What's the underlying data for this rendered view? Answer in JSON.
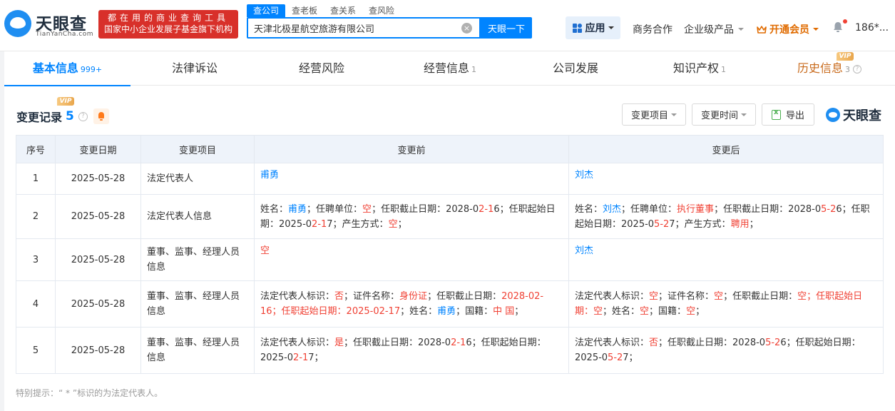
{
  "header": {
    "logo_text": "天眼查",
    "logo_sub": "TianYanCha.com",
    "promo_line1": "都在用的商业查询工具",
    "promo_line2": "国家中小企业发展子基金旗下机构",
    "search_tabs": [
      "查公司",
      "查老板",
      "查关系",
      "查风险"
    ],
    "search_value": "天津北极星航空旅游有限公司",
    "search_button": "天眼一下",
    "apps_label": "应用",
    "nav": {
      "business": "商务合作",
      "enterprise": "企业级产品",
      "vip": "开通会员",
      "user": "186*..."
    }
  },
  "tabs": [
    {
      "label": "基本信息",
      "count": "999+"
    },
    {
      "label": "法律诉讼",
      "count": ""
    },
    {
      "label": "经营风险",
      "count": ""
    },
    {
      "label": "经营信息",
      "count": "1"
    },
    {
      "label": "公司发展",
      "count": ""
    },
    {
      "label": "知识产权",
      "count": "1"
    },
    {
      "label": "历史信息",
      "count": "3"
    }
  ],
  "vip_badge": "VIP",
  "section": {
    "title": "变更记录",
    "count": "5",
    "filter_item": "变更项目",
    "filter_time": "变更时间",
    "export": "导出",
    "brand": "天眼查"
  },
  "table": {
    "headers": [
      "序号",
      "变更日期",
      "变更项目",
      "变更前",
      "变更后"
    ],
    "rows": [
      {
        "no": "1",
        "date": "2025-05-28",
        "item": "法定代表人"
      },
      {
        "no": "2",
        "date": "2025-05-28",
        "item": "法定代表人信息"
      },
      {
        "no": "3",
        "date": "2025-05-28",
        "item": "董事、监事、经理人员信息"
      },
      {
        "no": "4",
        "date": "2025-05-28",
        "item": "董事、监事、经理人员信息"
      },
      {
        "no": "5",
        "date": "2025-05-28",
        "item": "董事、监事、经理人员信息"
      }
    ],
    "text": {
      "r1_before": "甫勇",
      "r1_after": "刘杰",
      "r2b_a": "姓名：",
      "r2b_b": "甫勇",
      "r2b_c": "；任聘单位：",
      "r2b_d": "空",
      "r2b_e": "；任职截止日期：2028-0",
      "r2b_f": "2-1",
      "r2b_g": "6；任职起始日期：2025-0",
      "r2b_h": "2-1",
      "r2b_i": "7；产生方式：",
      "r2b_j": "空",
      "r2b_k": "；",
      "r2a_a": "姓名：",
      "r2a_b": "刘杰",
      "r2a_c": "；任聘单位：",
      "r2a_d": "执行董事",
      "r2a_e": "；任职截止日期：2028-0",
      "r2a_f": "5-2",
      "r2a_g": "6；任职起始日期：2025-0",
      "r2a_h": "5-2",
      "r2a_i": "7；产生方式：",
      "r2a_j": "聘用",
      "r2a_k": "；",
      "r3_before": "空",
      "r3_after": "刘杰",
      "r4b_a": "法定代表人标识：",
      "r4b_b": "否",
      "r4b_c": "；证件名称：",
      "r4b_d": "身份证",
      "r4b_e": "；任职截止日期：",
      "r4b_f": "2028-02-16；任职起始日期：2025-02-17",
      "r4b_g": "；姓名：",
      "r4b_h": "甫勇",
      "r4b_i": "；国籍：",
      "r4b_j": "中 国",
      "r4b_k": "；",
      "r4a_a": "法定代表人标识：",
      "r4a_b": "空",
      "r4a_c": "；证件名称：",
      "r4a_d": "空",
      "r4a_e": "；任职截止日期：",
      "r4a_f": "空；任职起始日期：空",
      "r4a_g": "；姓名：",
      "r4a_h": "空",
      "r4a_i": "；国籍：",
      "r4a_j": "空",
      "r4a_k": "；",
      "r5b_a": "法定代表人标识：",
      "r5b_b": "是",
      "r5b_c": "；任职截止日期：2028-0",
      "r5b_d": "2-1",
      "r5b_e": "6；任职起始日期：2025-0",
      "r5b_f": "2-1",
      "r5b_g": "7；",
      "r5a_a": "法定代表人标识：",
      "r5a_b": "否",
      "r5a_c": "；任职截止日期：2028-0",
      "r5a_d": "5-2",
      "r5a_e": "6；任职起始日期：2025-0",
      "r5a_f": "5-2",
      "r5a_g": "7；"
    }
  },
  "footnote": "特别提示：“ * ”标识的为法定代表人。",
  "colors": {
    "accent": "#0084ff",
    "highlight": "#f04134",
    "vip": "#e06b00",
    "promo": "#d8302a"
  }
}
